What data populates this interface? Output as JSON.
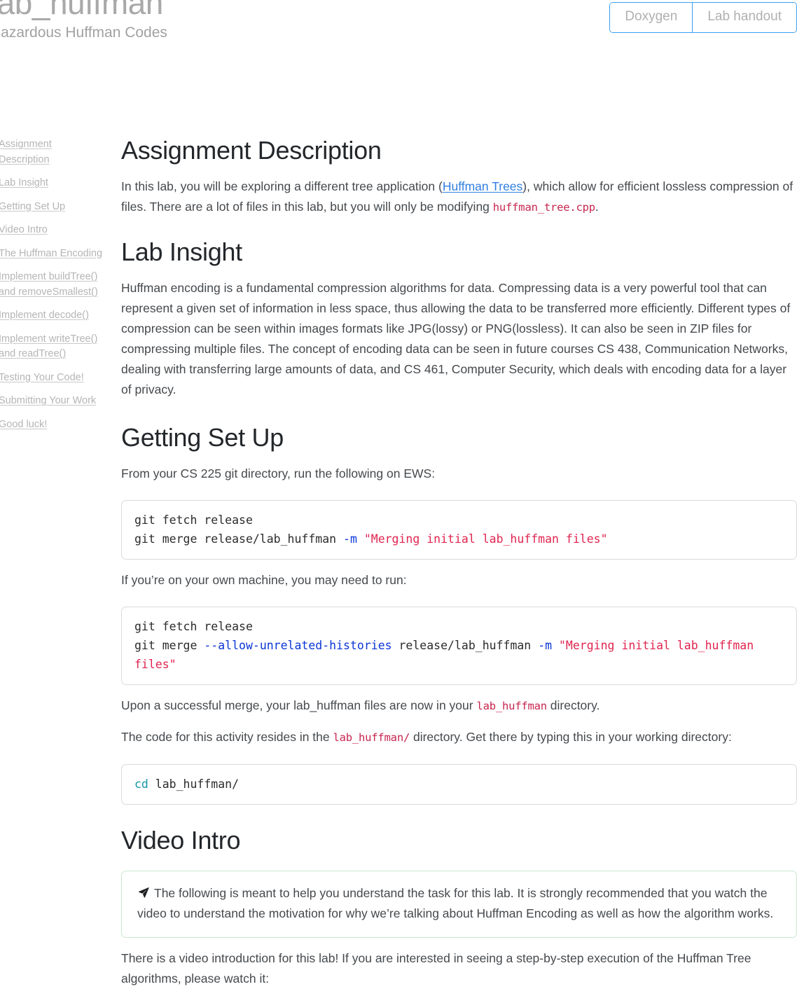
{
  "header": {
    "title": "lab_huffman",
    "subtitle": "Hazardous Huffman Codes",
    "buttons": [
      {
        "name": "doxygen",
        "label": "Doxygen"
      },
      {
        "name": "lab-handout",
        "label": "Lab handout"
      }
    ],
    "border_color": "#3aa0f5",
    "title_color": "#a9a9a9"
  },
  "sidebar": {
    "items": [
      {
        "label": "Assignment Description"
      },
      {
        "label": "Lab Insight"
      },
      {
        "label": "Getting Set Up"
      },
      {
        "label": "Video Intro"
      },
      {
        "label": "The Huffman Encoding"
      },
      {
        "label": "Implement buildTree() and removeSmallest()"
      },
      {
        "label": "Implement decode()"
      },
      {
        "label": "Implement writeTree() and readTree()"
      },
      {
        "label": "Testing Your Code!"
      },
      {
        "label": "Submitting Your Work"
      },
      {
        "label": "Good luck!"
      }
    ]
  },
  "main": {
    "assignment": {
      "heading": "Assignment Description",
      "para_1a": "In this lab, you will be exploring a different tree application (",
      "para_link": "Huffman Trees",
      "para_1b": "), which allow for efficient lossless compression of files. There are a lot of files in this lab, but you will only be modifying ",
      "para_code": "huffman_tree.cpp",
      "para_1c": "."
    },
    "lab_insight": {
      "heading": "Lab Insight",
      "paragraph": "Huffman encoding is a fundamental compression algorithms for data. Compressing data is a very powerful tool that can represent a given set of information in less space, thus allowing the data to be transferred more efficiently. Different types of compression can be seen within images formats like JPG(lossy) or PNG(lossless). It can also be seen in ZIP files for compressing multiple files. The concept of encoding data can be seen in future courses CS 438, Communication Networks, dealing with transferring large amounts of data, and CS 461, Computer Security, which deals with encoding data for a layer of privacy."
    },
    "getting_set_up": {
      "heading": "Getting Set Up",
      "intro": "From your CS 225 git directory, run the following on EWS:",
      "code_1": {
        "line1": "git fetch release",
        "line2_a": "git merge release/lab_huffman ",
        "line2_flag": "-m",
        "line2_str": " \"Merging initial lab_huffman files\""
      },
      "own_machine": "If you’re on your own machine, you may need to run:",
      "code_2": {
        "line1": "git fetch release",
        "line2_a": "git merge ",
        "line2_flag1": "--allow-unrelated-histories",
        "line2_b": " release/lab_huffman ",
        "line2_flag2": "-m",
        "line2_str": " \"Merging initial lab_huffman files\""
      },
      "after_merge_a": "Upon a successful merge, your lab_huffman files are now in your ",
      "after_merge_code": "lab_huffman",
      "after_merge_b": " directory.",
      "code_resides_a": "The code for this activity resides in the ",
      "code_resides_code": "lab_huffman/",
      "code_resides_b": " directory. Get there by typing this in your working directory:",
      "code_3": {
        "cmd": "cd",
        "arg": " lab_huffman/"
      }
    },
    "video_intro": {
      "heading": "Video Intro",
      "note_icon": "paper-plane-icon",
      "note_text": "The following is meant to help you understand the task for this lab. It is strongly recommended that you watch the video to understand the motivation for why we’re talking about Huffman Encoding as well as how the algorithm works.",
      "note_border_color": "#cbe8cf",
      "closing": "There is a video introduction for this lab! If you are interested in seeing a step-by-step execution of the Huffman Tree algorithms, please watch it:"
    }
  }
}
